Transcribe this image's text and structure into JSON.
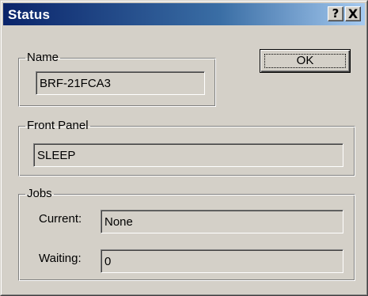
{
  "window": {
    "title": "Status",
    "help_button_label": "?",
    "close_button_label": "X"
  },
  "name_group": {
    "legend": "Name",
    "value": "BRF-21FCA3"
  },
  "ok_button": {
    "label": "OK"
  },
  "front_panel_group": {
    "legend": "Front Panel",
    "value": "SLEEP"
  },
  "jobs_group": {
    "legend": "Jobs",
    "current_label": "Current:",
    "current_value": "None",
    "waiting_label": "Waiting:",
    "waiting_value": "0"
  }
}
